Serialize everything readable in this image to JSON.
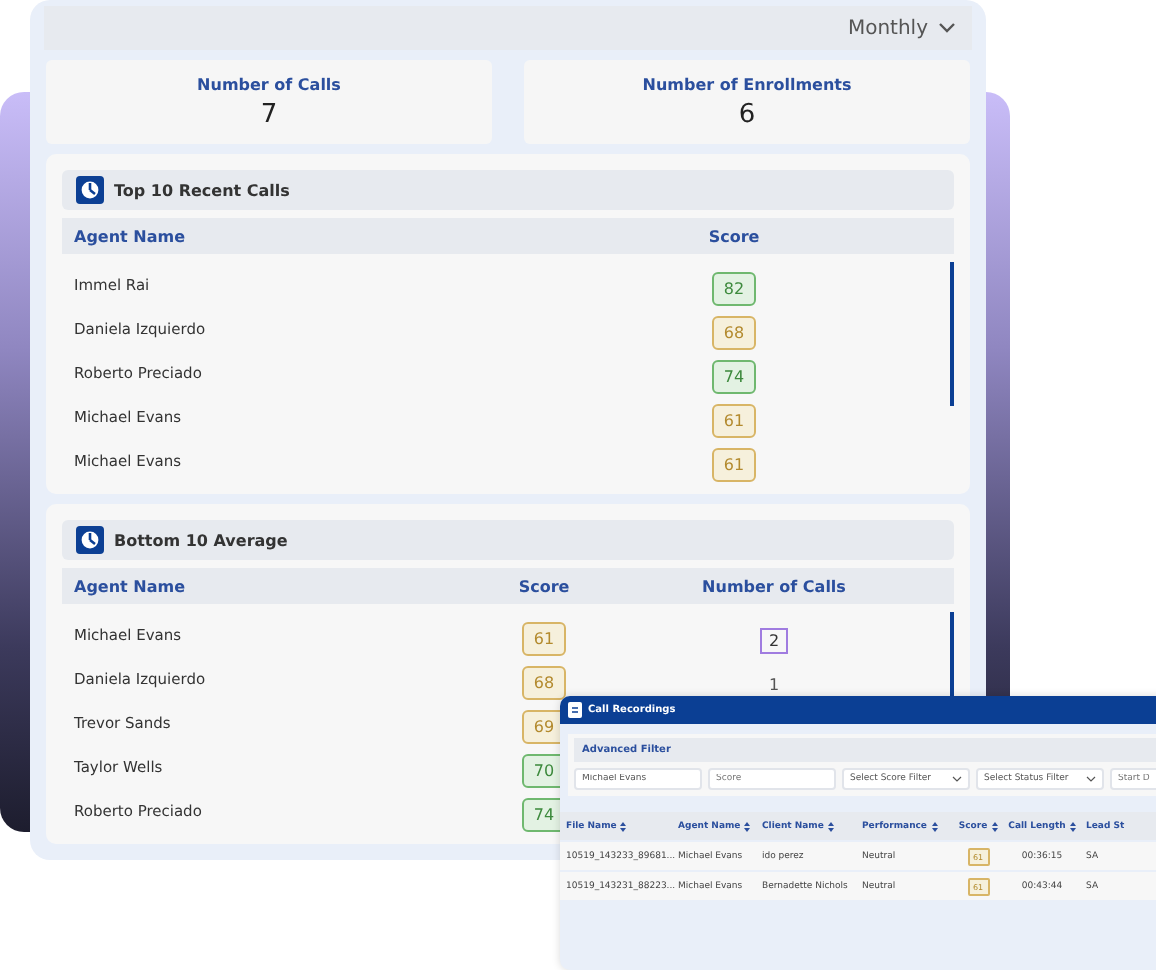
{
  "period_select": {
    "value": "Monthly"
  },
  "stats": [
    {
      "label": "Number of Calls",
      "value": "7"
    },
    {
      "label": "Number of Enrollments",
      "value": "6"
    }
  ],
  "recent_calls": {
    "title": "Top 10 Recent Calls",
    "columns": [
      "Agent Name",
      "Score"
    ],
    "rows": [
      {
        "agent": "Immel Rai",
        "score": "82",
        "kind": "high"
      },
      {
        "agent": "Daniela Izquierdo",
        "score": "68",
        "kind": "medium"
      },
      {
        "agent": "Roberto Preciado",
        "score": "74",
        "kind": "high"
      },
      {
        "agent": "Michael Evans",
        "score": "61",
        "kind": "medium"
      },
      {
        "agent": "Michael Evans",
        "score": "61",
        "kind": "medium"
      }
    ]
  },
  "bottom_average": {
    "title": "Bottom 10 Average",
    "columns": [
      "Agent Name",
      "Score",
      "Number of Calls"
    ],
    "rows": [
      {
        "agent": "Michael Evans",
        "score": "61",
        "kind": "medium",
        "calls": "2",
        "selected": true
      },
      {
        "agent": "Daniela Izquierdo",
        "score": "68",
        "kind": "medium",
        "calls": "1",
        "selected": false
      },
      {
        "agent": "Trevor Sands",
        "score": "69",
        "kind": "medium"
      },
      {
        "agent": "Taylor Wells",
        "score": "70",
        "kind": "high"
      },
      {
        "agent": "Roberto Preciado",
        "score": "74",
        "kind": "high"
      }
    ]
  },
  "call_recordings": {
    "title": "Call Recordings",
    "filter_title": "Advanced Filter",
    "filters": [
      {
        "kind": "input",
        "value": "Michael Evans"
      },
      {
        "kind": "input",
        "placeholder": "Score"
      },
      {
        "kind": "select",
        "placeholder": "Select Score Filter"
      },
      {
        "kind": "select",
        "placeholder": "Select Status Filter"
      },
      {
        "kind": "input",
        "placeholder": "Start D"
      }
    ],
    "columns": [
      "File Name",
      "Agent Name",
      "Client Name",
      "Performance",
      "Score",
      "Call Length",
      "Lead St"
    ],
    "rows": [
      {
        "file": "10519_143233_89681...",
        "agent": "Michael Evans",
        "client": "ido perez",
        "performance": "Neutral",
        "score": "61",
        "kind": "medium",
        "length": "00:36:15",
        "lead": "SA"
      },
      {
        "file": "10519_143231_88223...",
        "agent": "Michael Evans",
        "client": "Bernadette Nichols",
        "performance": "Neutral",
        "score": "61",
        "kind": "medium",
        "length": "00:43:44",
        "lead": "SA"
      }
    ]
  }
}
